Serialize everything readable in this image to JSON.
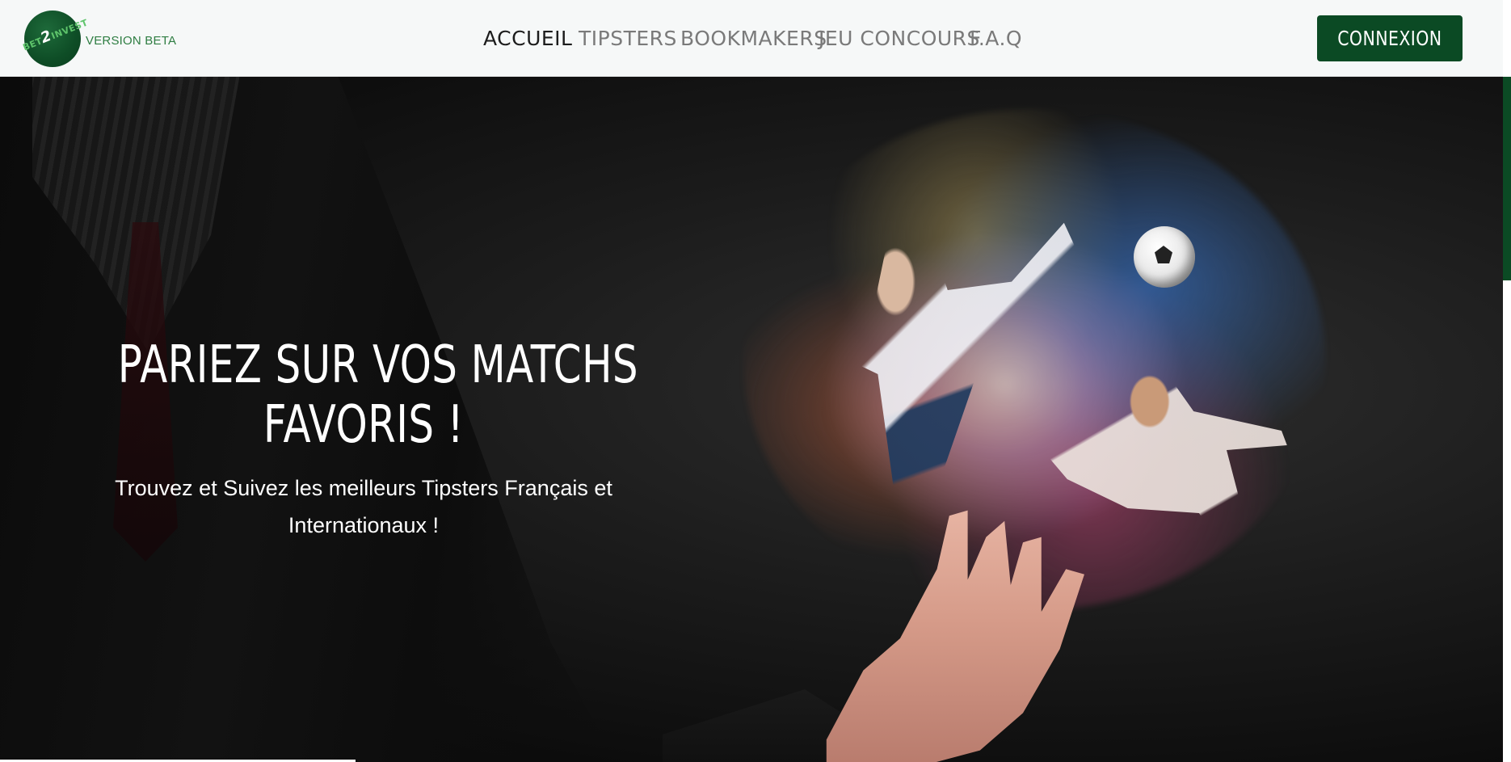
{
  "header": {
    "logo": {
      "text_top": "BET",
      "text_two": "2",
      "text_invest": "INVEST",
      "version_label": "VERSION BETA"
    },
    "nav": [
      {
        "label": "ACCUEIL",
        "active": true
      },
      {
        "label": "TIPSTERS",
        "active": false
      },
      {
        "label": "BOOKMAKERS",
        "active": false
      },
      {
        "label": "JEU CONCOURS",
        "active": false
      },
      {
        "label": "F.A.Q",
        "active": false
      }
    ],
    "connect_label": "CONNEXION"
  },
  "hero": {
    "title_line1": "PARIEZ SUR VOS MATCHS",
    "title_line2": "FAVORIS !",
    "subtitle_line1": "Trouvez et Suivez les meilleurs Tipsters Français et",
    "subtitle_line2": "Internationaux !",
    "image": "businessman-hand-football-players-image"
  },
  "colors": {
    "brand_green": "#0b4a24",
    "header_bg": "#f6f8f8",
    "nav_active": "#1c1c1c",
    "nav_inactive": "#7a7a7a",
    "version_text": "#2e7d42"
  }
}
